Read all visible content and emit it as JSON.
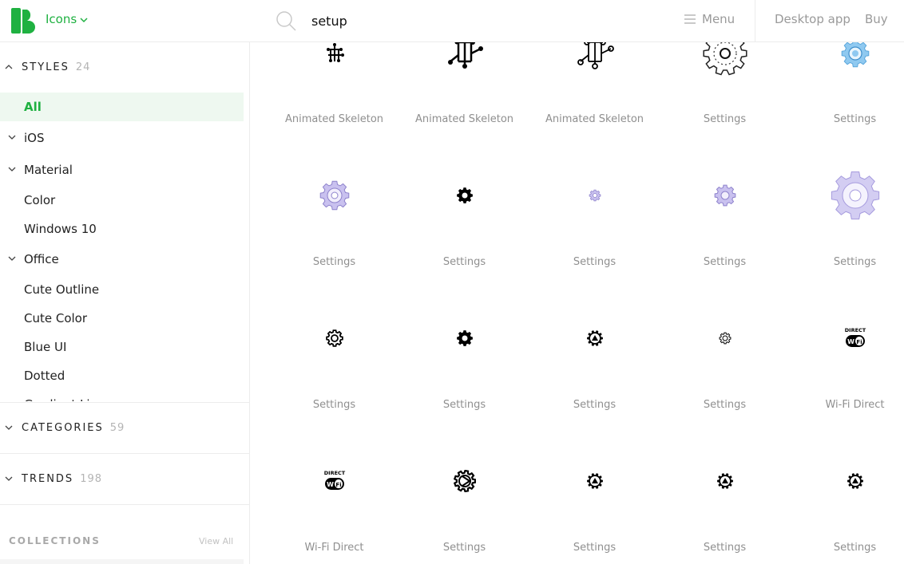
{
  "header": {
    "brand": "Icons",
    "search_value": "setup",
    "menu_label": "Menu",
    "desktop_link": "Desktop app",
    "buy_link": "Buy",
    "brand_color": "#1fb141"
  },
  "sidebar": {
    "styles": {
      "title": "STYLES",
      "count": "24"
    },
    "style_items": [
      {
        "label": "All",
        "active": true,
        "expandable": false
      },
      {
        "label": "iOS",
        "expandable": true
      },
      {
        "label": "Material",
        "expandable": true
      },
      {
        "label": "Color",
        "expandable": false
      },
      {
        "label": "Windows 10",
        "expandable": false
      },
      {
        "label": "Office",
        "expandable": true
      },
      {
        "label": "Cute Outline",
        "expandable": false
      },
      {
        "label": "Cute Color",
        "expandable": false
      },
      {
        "label": "Blue UI",
        "expandable": false
      },
      {
        "label": "Dotted",
        "expandable": false
      },
      {
        "label": "Gradient Line",
        "expandable": false
      }
    ],
    "categories": {
      "title": "CATEGORIES",
      "count": "59"
    },
    "trends": {
      "title": "TRENDS",
      "count": "198"
    },
    "collections": {
      "title": "COLLECTIONS",
      "view_all": "View All"
    }
  },
  "grid": {
    "rows": [
      [
        {
          "name": "Animated Skeleton",
          "icon": "skeleton-small-icon"
        },
        {
          "name": "Animated Skeleton",
          "icon": "skeleton-large-icon"
        },
        {
          "name": "Animated Skeleton",
          "icon": "skeleton-outline-icon"
        },
        {
          "name": "Settings",
          "icon": "gear-dotted-icon"
        },
        {
          "name": "Settings",
          "icon": "gear-blue-icon"
        }
      ],
      [
        {
          "name": "Settings",
          "icon": "gear-purple-icon"
        },
        {
          "name": "Settings",
          "icon": "gear-solid-icon"
        },
        {
          "name": "Settings",
          "icon": "gear-purple-tiny-icon"
        },
        {
          "name": "Settings",
          "icon": "gear-purple-small-icon"
        },
        {
          "name": "Settings",
          "icon": "gear-purple-large-icon"
        }
      ],
      [
        {
          "name": "Settings",
          "icon": "gear-outline-icon"
        },
        {
          "name": "Settings",
          "icon": "gear-solid-icon"
        },
        {
          "name": "Settings",
          "icon": "gear-badge-icon"
        },
        {
          "name": "Settings",
          "icon": "gear-thin-icon"
        },
        {
          "name": "Wi-Fi Direct",
          "icon": "wifi-direct-icon"
        }
      ],
      [
        {
          "name": "Wi-Fi Direct",
          "icon": "wifi-direct-icon"
        },
        {
          "name": "Settings",
          "icon": "gear-outline-bold-icon"
        },
        {
          "name": "Settings",
          "icon": "gear-badge-icon"
        },
        {
          "name": "Settings",
          "icon": "gear-badge-icon"
        },
        {
          "name": "Settings",
          "icon": "gear-badge-icon"
        }
      ]
    ]
  }
}
